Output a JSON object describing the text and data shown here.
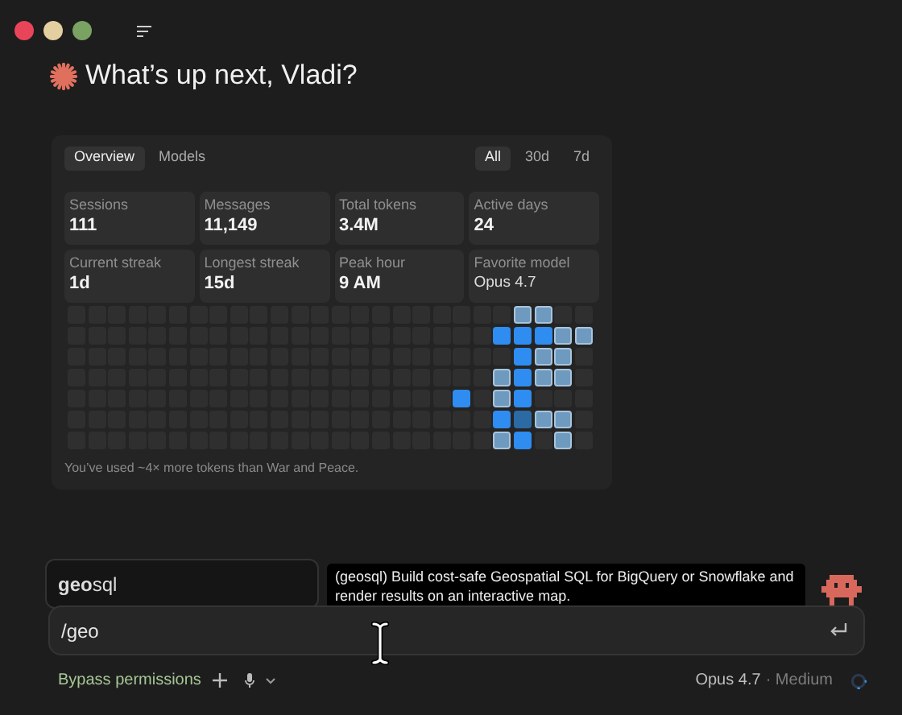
{
  "header": {
    "greeting": "What’s up next, Vladi?"
  },
  "stats_panel": {
    "view_tabs": [
      {
        "label": "Overview",
        "selected": true
      },
      {
        "label": "Models",
        "selected": false
      }
    ],
    "range_tabs": [
      {
        "label": "All",
        "selected": true
      },
      {
        "label": "30d",
        "selected": false
      },
      {
        "label": "7d",
        "selected": false
      }
    ],
    "stats": [
      {
        "label": "Sessions",
        "value": "111"
      },
      {
        "label": "Messages",
        "value": "11,149"
      },
      {
        "label": "Total tokens",
        "value": "3.4M"
      },
      {
        "label": "Active days",
        "value": "24"
      },
      {
        "label": "Current streak",
        "value": "1d"
      },
      {
        "label": "Longest streak",
        "value": "15d"
      },
      {
        "label": "Peak hour",
        "value": "9 AM"
      },
      {
        "label": "Favorite model",
        "value": "Opus 4.7",
        "kind": "text"
      }
    ],
    "heatmap": {
      "rows": [
        {
          "cells": [
            {
              "kind": "empty"
            },
            {
              "kind": "empty"
            },
            {
              "kind": "empty"
            },
            {
              "kind": "empty"
            },
            {
              "kind": "empty"
            },
            {
              "kind": "empty"
            },
            {
              "kind": "empty"
            },
            {
              "kind": "empty"
            },
            {
              "kind": "empty"
            },
            {
              "kind": "empty"
            },
            {
              "kind": "empty"
            },
            {
              "kind": "empty"
            },
            {
              "kind": "empty"
            },
            {
              "kind": "empty"
            },
            {
              "kind": "empty"
            },
            {
              "kind": "empty"
            },
            {
              "kind": "empty"
            },
            {
              "kind": "empty"
            },
            {
              "kind": "empty"
            },
            {
              "kind": "empty"
            },
            {
              "kind": "empty"
            },
            {
              "kind": "empty"
            },
            {
              "kind": "light"
            },
            {
              "kind": "light"
            },
            {
              "kind": "empty"
            },
            {
              "kind": "empty"
            }
          ]
        },
        {
          "cells": [
            {
              "kind": "empty"
            },
            {
              "kind": "empty"
            },
            {
              "kind": "empty"
            },
            {
              "kind": "empty"
            },
            {
              "kind": "empty"
            },
            {
              "kind": "empty"
            },
            {
              "kind": "empty"
            },
            {
              "kind": "empty"
            },
            {
              "kind": "empty"
            },
            {
              "kind": "empty"
            },
            {
              "kind": "empty"
            },
            {
              "kind": "empty"
            },
            {
              "kind": "empty"
            },
            {
              "kind": "empty"
            },
            {
              "kind": "empty"
            },
            {
              "kind": "empty"
            },
            {
              "kind": "empty"
            },
            {
              "kind": "empty"
            },
            {
              "kind": "empty"
            },
            {
              "kind": "empty"
            },
            {
              "kind": "empty"
            },
            {
              "kind": "strong"
            },
            {
              "kind": "strong"
            },
            {
              "kind": "strong"
            },
            {
              "kind": "light"
            },
            {
              "kind": "light"
            }
          ]
        },
        {
          "cells": [
            {
              "kind": "empty"
            },
            {
              "kind": "empty"
            },
            {
              "kind": "empty"
            },
            {
              "kind": "empty"
            },
            {
              "kind": "empty"
            },
            {
              "kind": "empty"
            },
            {
              "kind": "empty"
            },
            {
              "kind": "empty"
            },
            {
              "kind": "empty"
            },
            {
              "kind": "empty"
            },
            {
              "kind": "empty"
            },
            {
              "kind": "empty"
            },
            {
              "kind": "empty"
            },
            {
              "kind": "empty"
            },
            {
              "kind": "empty"
            },
            {
              "kind": "empty"
            },
            {
              "kind": "empty"
            },
            {
              "kind": "empty"
            },
            {
              "kind": "empty"
            },
            {
              "kind": "empty"
            },
            {
              "kind": "empty"
            },
            {
              "kind": "empty"
            },
            {
              "kind": "strong"
            },
            {
              "kind": "light"
            },
            {
              "kind": "light"
            },
            {
              "kind": "empty"
            }
          ]
        },
        {
          "cells": [
            {
              "kind": "empty"
            },
            {
              "kind": "empty"
            },
            {
              "kind": "empty"
            },
            {
              "kind": "empty"
            },
            {
              "kind": "empty"
            },
            {
              "kind": "empty"
            },
            {
              "kind": "empty"
            },
            {
              "kind": "empty"
            },
            {
              "kind": "empty"
            },
            {
              "kind": "empty"
            },
            {
              "kind": "empty"
            },
            {
              "kind": "empty"
            },
            {
              "kind": "empty"
            },
            {
              "kind": "empty"
            },
            {
              "kind": "empty"
            },
            {
              "kind": "empty"
            },
            {
              "kind": "empty"
            },
            {
              "kind": "empty"
            },
            {
              "kind": "empty"
            },
            {
              "kind": "empty"
            },
            {
              "kind": "empty"
            },
            {
              "kind": "light"
            },
            {
              "kind": "strong"
            },
            {
              "kind": "light"
            },
            {
              "kind": "light"
            },
            {
              "kind": "empty"
            }
          ]
        },
        {
          "cells": [
            {
              "kind": "empty"
            },
            {
              "kind": "empty"
            },
            {
              "kind": "empty"
            },
            {
              "kind": "empty"
            },
            {
              "kind": "empty"
            },
            {
              "kind": "empty"
            },
            {
              "kind": "empty"
            },
            {
              "kind": "empty"
            },
            {
              "kind": "empty"
            },
            {
              "kind": "empty"
            },
            {
              "kind": "empty"
            },
            {
              "kind": "empty"
            },
            {
              "kind": "empty"
            },
            {
              "kind": "empty"
            },
            {
              "kind": "empty"
            },
            {
              "kind": "empty"
            },
            {
              "kind": "empty"
            },
            {
              "kind": "empty"
            },
            {
              "kind": "empty"
            },
            {
              "kind": "strong"
            },
            {
              "kind": "empty"
            },
            {
              "kind": "light"
            },
            {
              "kind": "strong"
            },
            {
              "kind": "empty"
            },
            {
              "kind": "empty"
            },
            {
              "kind": "empty"
            }
          ]
        },
        {
          "cells": [
            {
              "kind": "empty"
            },
            {
              "kind": "empty"
            },
            {
              "kind": "empty"
            },
            {
              "kind": "empty"
            },
            {
              "kind": "empty"
            },
            {
              "kind": "empty"
            },
            {
              "kind": "empty"
            },
            {
              "kind": "empty"
            },
            {
              "kind": "empty"
            },
            {
              "kind": "empty"
            },
            {
              "kind": "empty"
            },
            {
              "kind": "empty"
            },
            {
              "kind": "empty"
            },
            {
              "kind": "empty"
            },
            {
              "kind": "empty"
            },
            {
              "kind": "empty"
            },
            {
              "kind": "empty"
            },
            {
              "kind": "empty"
            },
            {
              "kind": "empty"
            },
            {
              "kind": "empty"
            },
            {
              "kind": "empty"
            },
            {
              "kind": "strong"
            },
            {
              "kind": "medium"
            },
            {
              "kind": "light"
            },
            {
              "kind": "light"
            },
            {
              "kind": "empty"
            }
          ]
        },
        {
          "cells": [
            {
              "kind": "empty"
            },
            {
              "kind": "empty"
            },
            {
              "kind": "empty"
            },
            {
              "kind": "empty"
            },
            {
              "kind": "empty"
            },
            {
              "kind": "empty"
            },
            {
              "kind": "empty"
            },
            {
              "kind": "empty"
            },
            {
              "kind": "empty"
            },
            {
              "kind": "empty"
            },
            {
              "kind": "empty"
            },
            {
              "kind": "empty"
            },
            {
              "kind": "empty"
            },
            {
              "kind": "empty"
            },
            {
              "kind": "empty"
            },
            {
              "kind": "empty"
            },
            {
              "kind": "empty"
            },
            {
              "kind": "empty"
            },
            {
              "kind": "empty"
            },
            {
              "kind": "empty"
            },
            {
              "kind": "empty"
            },
            {
              "kind": "light"
            },
            {
              "kind": "strong"
            },
            {
              "kind": "empty"
            },
            {
              "kind": "light"
            },
            {
              "kind": "empty"
            }
          ]
        }
      ]
    },
    "caption": "You’ve used ~4× more tokens than War and Peace."
  },
  "autocomplete": {
    "suggestion": "**geo**sql",
    "description": "(geosql) Build cost-safe Geospatial SQL for BigQuery or Snowflake and render results on an interactive map."
  },
  "prompt": {
    "value": "/geo"
  },
  "footer": {
    "mode": "Bypass permissions",
    "model": "Opus 4.7",
    "effort": "· Medium"
  }
}
